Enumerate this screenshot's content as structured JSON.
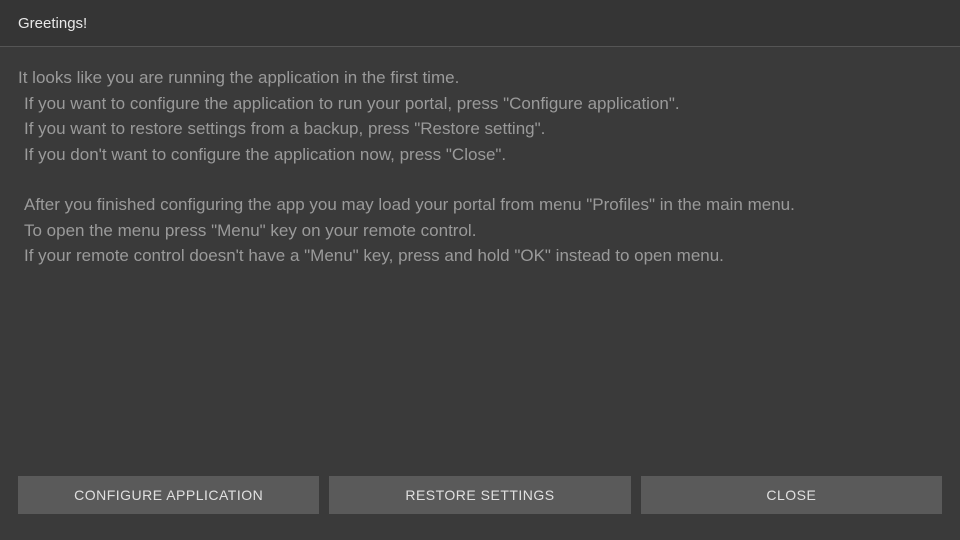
{
  "header": {
    "title": "Greetings!"
  },
  "body": {
    "line1": "It looks like you are running the application in the first time.",
    "line2": "If you want to configure the application to run your portal, press \"Configure application\".",
    "line3": "If you want to restore settings from a backup, press \"Restore setting\".",
    "line4": "If you don't want to configure the application now, press \"Close\".",
    "line5": "After you finished configuring the app you may load your portal from menu \"Profiles\" in the main menu.",
    "line6": "To open the menu press \"Menu\" key on your remote control.",
    "line7": "If your remote control doesn't have a \"Menu\" key, press and hold \"OK\" instead to open menu."
  },
  "buttons": {
    "configure": "CONFIGURE APPLICATION",
    "restore": "RESTORE SETTINGS",
    "close": "CLOSE"
  }
}
